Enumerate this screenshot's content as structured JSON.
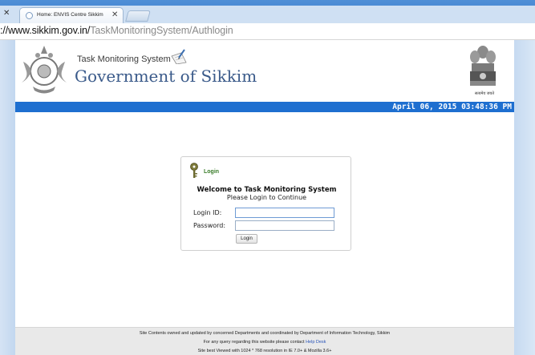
{
  "browser": {
    "tab_title": "Home: ENVIS Centre Sikkim",
    "url_host": "://www.sikkim.gov.in/",
    "url_path": "TaskMonitoringSystem/Authlogin"
  },
  "header": {
    "system_name": "Task Monitoring System",
    "government_name": "Government of Sikkim",
    "motto": "सत्यमेव जयते"
  },
  "banner": {
    "datetime": "April 06, 2015 03:48:36 PM"
  },
  "login": {
    "title": "Login",
    "welcome": "Welcome to Task Monitoring System",
    "subtitle": "Please Login to Continue",
    "id_label": "Login ID:",
    "password_label": "Password:",
    "id_value": "",
    "password_value": "",
    "button_label": "Login"
  },
  "footer": {
    "line1": "Site Contents owned and updated by concerned Departments and coordinated by Department of Information Technology, Sikkim",
    "line2_prefix": "For any query regarding this website please contact ",
    "help_link": "Help Desk",
    "line3": "Site best Viewed with 1024 * 768 resolution in IE 7.0+ & Mozilla 3.6+"
  },
  "colors": {
    "banner_blue": "#1e6fd0",
    "brand_blue": "#3a5a8a",
    "login_green": "#3a7d2a"
  },
  "icons": [
    "sikkim-emblem-icon",
    "pen-paper-icon",
    "national-emblem-icon",
    "key-icon",
    "close-icon",
    "page-favicon-icon"
  ]
}
